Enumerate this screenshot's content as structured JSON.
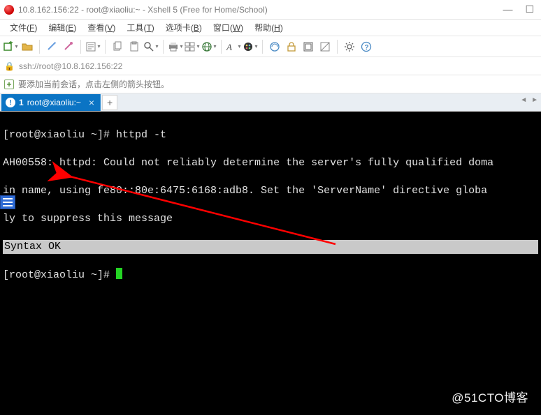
{
  "titlebar": {
    "text": "10.8.162.156:22 - root@xiaoliu:~ - Xshell 5 (Free for Home/School)"
  },
  "menubar": {
    "items": [
      {
        "label": "文件",
        "mn": "F"
      },
      {
        "label": "编辑",
        "mn": "E"
      },
      {
        "label": "查看",
        "mn": "V"
      },
      {
        "label": "工具",
        "mn": "T"
      },
      {
        "label": "选项卡",
        "mn": "B"
      },
      {
        "label": "窗口",
        "mn": "W"
      },
      {
        "label": "帮助",
        "mn": "H"
      }
    ]
  },
  "toolbar": {
    "buttons": [
      {
        "name": "new-session",
        "dd": true
      },
      {
        "name": "open",
        "dd": false
      },
      {
        "name": "reconnect",
        "dd": false
      },
      {
        "name": "disconnect",
        "dd": false
      },
      {
        "name": "properties",
        "dd": true
      },
      {
        "name": "copy",
        "dd": false
      },
      {
        "name": "paste",
        "dd": false
      },
      {
        "name": "find",
        "dd": true
      },
      {
        "name": "print",
        "dd": true
      },
      {
        "name": "layout",
        "dd": true
      },
      {
        "name": "globe",
        "dd": true
      },
      {
        "name": "font",
        "dd": true
      },
      {
        "name": "color",
        "dd": true
      },
      {
        "name": "encoding",
        "dd": false
      },
      {
        "name": "lock",
        "dd": false
      },
      {
        "name": "fullscreen",
        "dd": false
      },
      {
        "name": "transparency",
        "dd": false
      },
      {
        "name": "settings",
        "dd": false
      },
      {
        "name": "help",
        "dd": false
      }
    ]
  },
  "addrbar": {
    "text": "ssh://root@10.8.162.156:22"
  },
  "hintbar": {
    "text": "要添加当前会话，点击左侧的箭头按钮。"
  },
  "tabs": {
    "active": {
      "label": "root@xiaoliu:~",
      "num": "1"
    }
  },
  "terminal": {
    "lines": [
      "[root@xiaoliu ~]# httpd -t",
      "AH00558: httpd: Could not reliably determine the server's fully qualified doma",
      "in name, using fe80::80e:6475:6168:adb8. Set the 'ServerName' directive globa",
      "ly to suppress this message"
    ],
    "highlight": "Syntax OK",
    "prompt2": "[root@xiaoliu ~]# "
  },
  "watermark": "@51CTO博客"
}
